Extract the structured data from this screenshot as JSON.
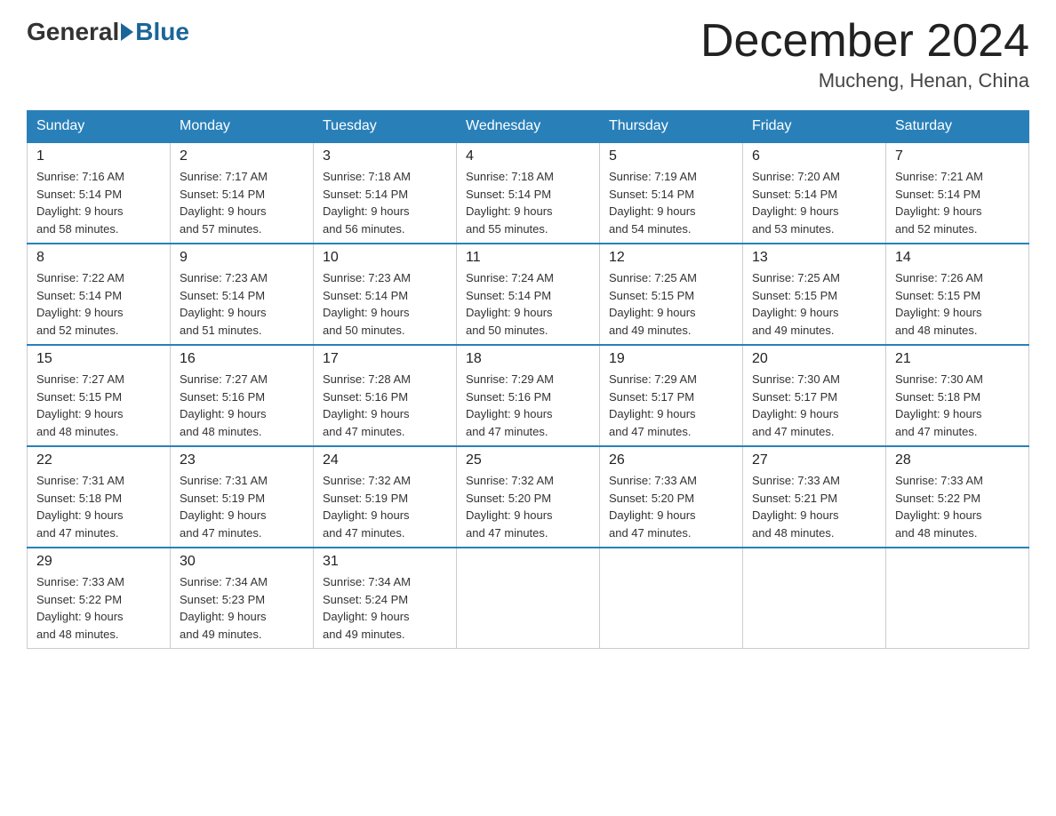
{
  "header": {
    "logo_general": "General",
    "logo_blue": "Blue",
    "month_title": "December 2024",
    "location": "Mucheng, Henan, China"
  },
  "weekdays": [
    "Sunday",
    "Monday",
    "Tuesday",
    "Wednesday",
    "Thursday",
    "Friday",
    "Saturday"
  ],
  "weeks": [
    [
      {
        "day": "1",
        "sunrise": "7:16 AM",
        "sunset": "5:14 PM",
        "daylight": "9 hours and 58 minutes."
      },
      {
        "day": "2",
        "sunrise": "7:17 AM",
        "sunset": "5:14 PM",
        "daylight": "9 hours and 57 minutes."
      },
      {
        "day": "3",
        "sunrise": "7:18 AM",
        "sunset": "5:14 PM",
        "daylight": "9 hours and 56 minutes."
      },
      {
        "day": "4",
        "sunrise": "7:18 AM",
        "sunset": "5:14 PM",
        "daylight": "9 hours and 55 minutes."
      },
      {
        "day": "5",
        "sunrise": "7:19 AM",
        "sunset": "5:14 PM",
        "daylight": "9 hours and 54 minutes."
      },
      {
        "day": "6",
        "sunrise": "7:20 AM",
        "sunset": "5:14 PM",
        "daylight": "9 hours and 53 minutes."
      },
      {
        "day": "7",
        "sunrise": "7:21 AM",
        "sunset": "5:14 PM",
        "daylight": "9 hours and 52 minutes."
      }
    ],
    [
      {
        "day": "8",
        "sunrise": "7:22 AM",
        "sunset": "5:14 PM",
        "daylight": "9 hours and 52 minutes."
      },
      {
        "day": "9",
        "sunrise": "7:23 AM",
        "sunset": "5:14 PM",
        "daylight": "9 hours and 51 minutes."
      },
      {
        "day": "10",
        "sunrise": "7:23 AM",
        "sunset": "5:14 PM",
        "daylight": "9 hours and 50 minutes."
      },
      {
        "day": "11",
        "sunrise": "7:24 AM",
        "sunset": "5:14 PM",
        "daylight": "9 hours and 50 minutes."
      },
      {
        "day": "12",
        "sunrise": "7:25 AM",
        "sunset": "5:15 PM",
        "daylight": "9 hours and 49 minutes."
      },
      {
        "day": "13",
        "sunrise": "7:25 AM",
        "sunset": "5:15 PM",
        "daylight": "9 hours and 49 minutes."
      },
      {
        "day": "14",
        "sunrise": "7:26 AM",
        "sunset": "5:15 PM",
        "daylight": "9 hours and 48 minutes."
      }
    ],
    [
      {
        "day": "15",
        "sunrise": "7:27 AM",
        "sunset": "5:15 PM",
        "daylight": "9 hours and 48 minutes."
      },
      {
        "day": "16",
        "sunrise": "7:27 AM",
        "sunset": "5:16 PM",
        "daylight": "9 hours and 48 minutes."
      },
      {
        "day": "17",
        "sunrise": "7:28 AM",
        "sunset": "5:16 PM",
        "daylight": "9 hours and 47 minutes."
      },
      {
        "day": "18",
        "sunrise": "7:29 AM",
        "sunset": "5:16 PM",
        "daylight": "9 hours and 47 minutes."
      },
      {
        "day": "19",
        "sunrise": "7:29 AM",
        "sunset": "5:17 PM",
        "daylight": "9 hours and 47 minutes."
      },
      {
        "day": "20",
        "sunrise": "7:30 AM",
        "sunset": "5:17 PM",
        "daylight": "9 hours and 47 minutes."
      },
      {
        "day": "21",
        "sunrise": "7:30 AM",
        "sunset": "5:18 PM",
        "daylight": "9 hours and 47 minutes."
      }
    ],
    [
      {
        "day": "22",
        "sunrise": "7:31 AM",
        "sunset": "5:18 PM",
        "daylight": "9 hours and 47 minutes."
      },
      {
        "day": "23",
        "sunrise": "7:31 AM",
        "sunset": "5:19 PM",
        "daylight": "9 hours and 47 minutes."
      },
      {
        "day": "24",
        "sunrise": "7:32 AM",
        "sunset": "5:19 PM",
        "daylight": "9 hours and 47 minutes."
      },
      {
        "day": "25",
        "sunrise": "7:32 AM",
        "sunset": "5:20 PM",
        "daylight": "9 hours and 47 minutes."
      },
      {
        "day": "26",
        "sunrise": "7:33 AM",
        "sunset": "5:20 PM",
        "daylight": "9 hours and 47 minutes."
      },
      {
        "day": "27",
        "sunrise": "7:33 AM",
        "sunset": "5:21 PM",
        "daylight": "9 hours and 48 minutes."
      },
      {
        "day": "28",
        "sunrise": "7:33 AM",
        "sunset": "5:22 PM",
        "daylight": "9 hours and 48 minutes."
      }
    ],
    [
      {
        "day": "29",
        "sunrise": "7:33 AM",
        "sunset": "5:22 PM",
        "daylight": "9 hours and 48 minutes."
      },
      {
        "day": "30",
        "sunrise": "7:34 AM",
        "sunset": "5:23 PM",
        "daylight": "9 hours and 49 minutes."
      },
      {
        "day": "31",
        "sunrise": "7:34 AM",
        "sunset": "5:24 PM",
        "daylight": "9 hours and 49 minutes."
      },
      null,
      null,
      null,
      null
    ]
  ]
}
